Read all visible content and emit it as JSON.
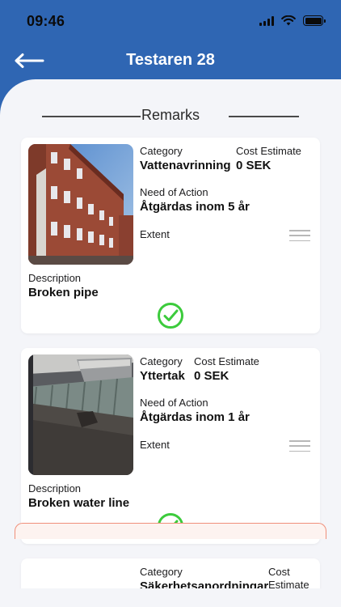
{
  "status_bar": {
    "time": "09:46",
    "icons": [
      "cellular-signal-icon",
      "wifi-icon",
      "battery-icon"
    ]
  },
  "nav": {
    "back_icon": "arrow-left-icon",
    "title": "Testaren 28"
  },
  "section": {
    "title": "Remarks"
  },
  "labels": {
    "category": "Category",
    "cost_estimate": "Cost Estimate",
    "need_of_action": "Need of Action",
    "extent": "Extent",
    "description": "Description"
  },
  "remarks": [
    {
      "photo": "brick-building-photo",
      "category": "Vattenavrinning",
      "cost_estimate": "0 SEK",
      "need_of_action": "Åtgärdas inom 5 år",
      "extent": "",
      "description": "Broken pipe",
      "status_icon": "check-circle-icon"
    },
    {
      "photo": "roof-photo",
      "category": "Yttertak",
      "cost_estimate": "0 SEK",
      "need_of_action": "Åtgärdas inom 1 år",
      "extent": "",
      "description": "Broken water line",
      "status_icon": "check-circle-icon"
    },
    {
      "category": "Säkerhetsanordningar",
      "cost_estimate_label_line1": "Cost",
      "cost_estimate_label_line2": "Estimate"
    }
  ],
  "colors": {
    "header_blue": "#2f66b3",
    "sheet_bg": "#f4f5f9",
    "check_green": "#3ccb3c",
    "bottom_bar_border": "#f08f7a"
  }
}
